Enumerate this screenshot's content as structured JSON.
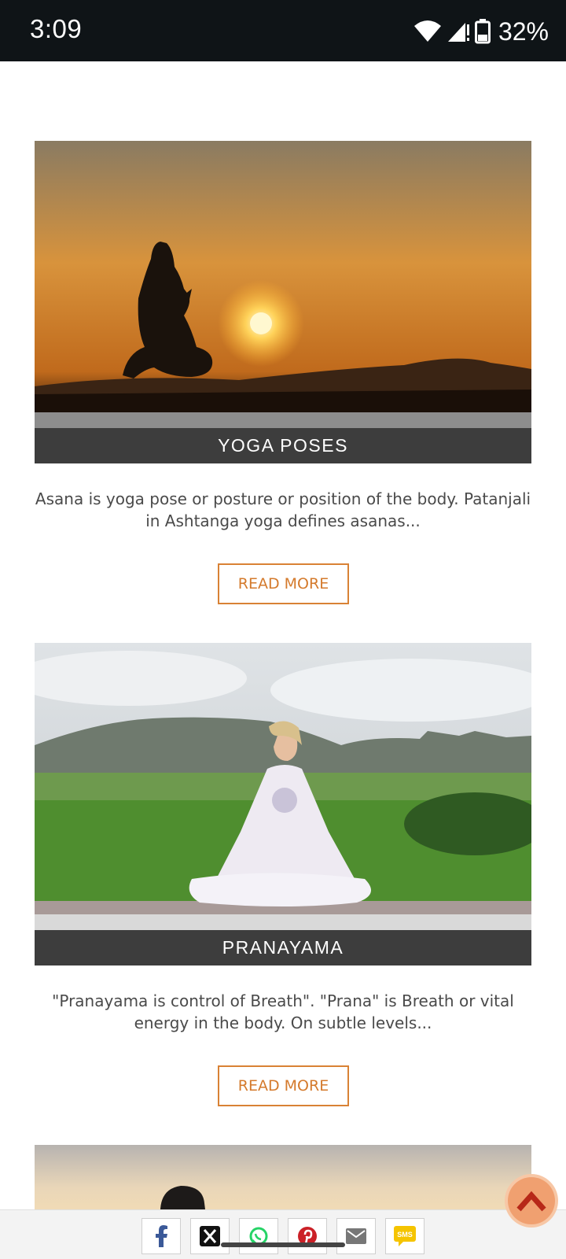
{
  "status": {
    "time": "3:09",
    "battery": "32%"
  },
  "peek_link": "Read more",
  "cards": [
    {
      "title": "YOGA POSES",
      "description": "Asana is yoga pose or posture or position of the body. Patanjali in Ashtanga yoga defines asanas...",
      "button": "READ MORE"
    },
    {
      "title": "PRANAYAMA",
      "description": "\"Pranayama is control of Breath\". \"Prana\" is Breath or vital energy in the body. On subtle levels...",
      "button": "READ MORE"
    }
  ],
  "share": {
    "sms_label": "SMS"
  },
  "colors": {
    "accent": "#d98235",
    "title_bar": "#3d3d3d",
    "status_bar": "#0f1417"
  }
}
